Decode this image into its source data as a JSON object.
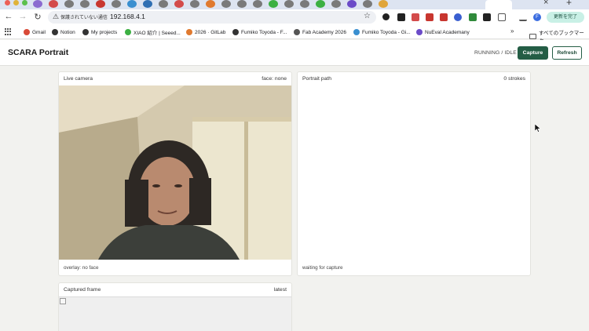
{
  "browser": {
    "address": {
      "security_label": "保護されていない通信",
      "url": "192.168.4.1"
    },
    "update_button": "更新を完了",
    "profile_initial": "F",
    "bookmarks": [
      {
        "label": "Gmail",
        "color": "#d94a38"
      },
      {
        "label": "Notion",
        "color": "#333333"
      },
      {
        "label": "My projects",
        "color": "#333333"
      },
      {
        "label": "XIAO 紹介 | Seeed...",
        "color": "#3cb043"
      },
      {
        "label": "2026 · GitLab",
        "color": "#e07a2f"
      },
      {
        "label": "Fumiko Toyoda - F...",
        "color": "#333333"
      },
      {
        "label": "Fab Academy 2026",
        "color": "#555555"
      },
      {
        "label": "Fumiko Toyoda - Gi...",
        "color": "#3a8fd0"
      },
      {
        "label": "NuEval Academany",
        "color": "#6b4bc8"
      }
    ],
    "bookmarks_folder": "すべてのブックマーク",
    "more_bookmarks": "»"
  },
  "app": {
    "title": "SCARA Portrait",
    "status": "RUNNING / IDLE",
    "capture_label": "Capture",
    "refresh_label": "Refresh"
  },
  "live_camera": {
    "title": "Live camera",
    "meta": "face: none",
    "footer": "overlay: no face"
  },
  "portrait_path": {
    "title": "Portrait path",
    "meta": "0 strokes",
    "footer": "waiting for capture"
  },
  "captured_frame": {
    "title": "Captured frame",
    "meta": "latest"
  },
  "colors": {
    "accent": "#245d45",
    "page_bg": "#f2f2ef"
  }
}
